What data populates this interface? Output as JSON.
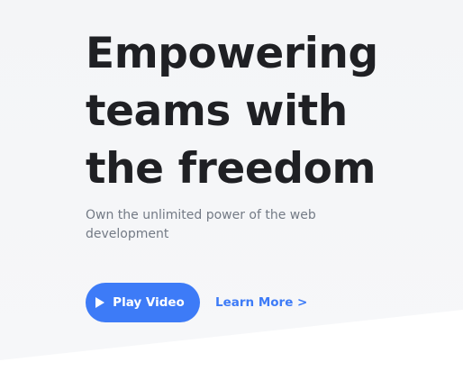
{
  "hero": {
    "headline_lines": [
      "Empowering",
      "teams with",
      "the freedom"
    ],
    "subtitle": "Own the unlimited power of the web development",
    "primary_button": {
      "label": "Play Video",
      "icon": "play-icon"
    },
    "secondary_link": {
      "label": "Learn More >"
    }
  },
  "colors": {
    "background": "#f5f6f8",
    "headline": "#1f2024",
    "subtitle": "#737a85",
    "accent": "#3d7bf7"
  }
}
